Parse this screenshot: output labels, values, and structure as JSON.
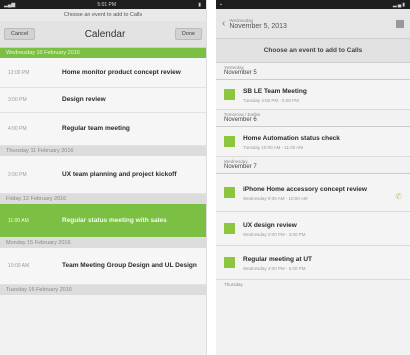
{
  "left": {
    "status_time": "5:01 PM",
    "hint": "Choose an event to add to Calls",
    "cancel_label": "Cancel",
    "title": "Calendar",
    "done_label": "Done",
    "date_header": "Wednesday 10 February 2016",
    "events": [
      {
        "time": "12:00 PM",
        "name": "Home monitor product concept review"
      },
      {
        "time": "3:00 PM",
        "name": "Design review"
      },
      {
        "time": "4:00 PM",
        "name": "Regular team meeting"
      }
    ],
    "sep1": "Thursday 11 February 2016",
    "events2": [
      {
        "time": "2:00 PM",
        "name": "UX team planning and project kickoff"
      }
    ],
    "sep2": "Friday 12 February 2016",
    "selected_event": {
      "time": "11:00 AM",
      "name": "Regular status meeting with sales"
    },
    "sep3": "Monday 15 February 2016",
    "events3": [
      {
        "time": "10:00 AM",
        "name": "Team Meeting Group Design and UL Design"
      }
    ],
    "sep4": "Tuesday 16 February 2016"
  },
  "right": {
    "ab_small": "Wednesday",
    "ab_big": "November 5, 2013",
    "banner": "Choose an event to add to Calls",
    "groups": [
      {
        "small": "Yesterday",
        "large": "November 5",
        "events": [
          {
            "name": "SB LE Team Meeting",
            "sub": "Tuesday 4:00 PM - 5:00 PM"
          }
        ]
      },
      {
        "small": "Tomorrow / Earlier",
        "large": "November 6",
        "events": [
          {
            "name": "Home Automation status check",
            "sub": "Tuesday 10:00 AM - 11:00 AM"
          }
        ]
      },
      {
        "small": "Wednesday",
        "large": "November 7",
        "events": [
          {
            "name": "iPhone Home accessory concept review",
            "sub": "Wednesday 9:00 AM - 10:00 AM",
            "phone": true
          },
          {
            "name": "UX design review",
            "sub": "Wednesday 2:00 PM - 3:00 PM"
          },
          {
            "name": "Regular meeting at UT",
            "sub": "Wednesday 4:00 PM - 5:00 PM"
          }
        ]
      }
    ],
    "footer_small": "Thursday"
  },
  "colors": {
    "accent": "#7cc043",
    "event_square": "#8cc63f"
  }
}
